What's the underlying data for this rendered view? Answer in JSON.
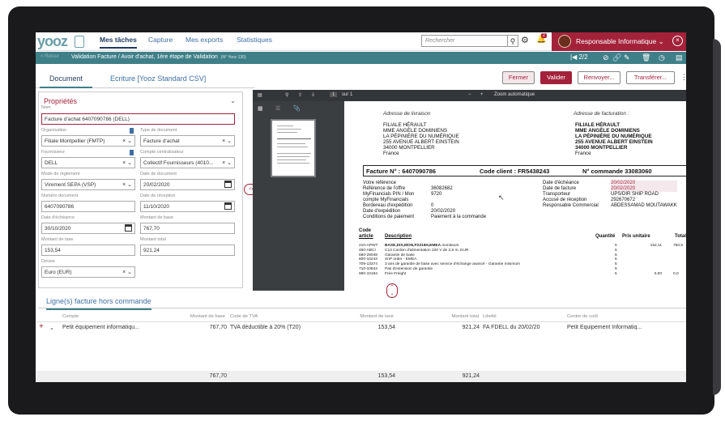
{
  "app": {
    "logo": "yooz"
  },
  "nav": {
    "items": [
      "Mes tâches",
      "Capture",
      "Mes exports",
      "Statistiques"
    ]
  },
  "search": {
    "placeholder": "Rechercher"
  },
  "notifications": {
    "count": "2"
  },
  "user": {
    "name": "Responsable Informatique"
  },
  "breadcrumb": {
    "back": "< Retour",
    "title": "Validation Facture / Avoir d'achat, 1ère étape de Validation",
    "sub": "(N° Yooz 130)"
  },
  "pager": {
    "text": "2/2"
  },
  "tabs": [
    "Document",
    "Ecriture [Yooz Standard CSV]"
  ],
  "actions": {
    "fermer": "Fermer",
    "valider": "Valider",
    "renvoyer": "Renvoyer...",
    "transferer": "Transférer..."
  },
  "props": {
    "title": "Propriétés",
    "nom_label": "Nom",
    "nom": "Facture d'achat 6407090786 (DELL)",
    "org_label": "Organisation",
    "org": "Filiale Montpellier (FMTP)",
    "type_label": "Type de document",
    "type": "Facture d'achat",
    "fourn_label": "Fournisseur",
    "fourn": "DELL",
    "compte_label": "Compte centralisateur",
    "compte": "Collectif Fournisseurs (4010...",
    "mode_label": "Mode de règlement",
    "mode": "Virement SEPA (VSP)",
    "datedoc_label": "Date de document",
    "datedoc": "20/02/2020",
    "numdoc_label": "Numéro document",
    "numdoc": "6407090786",
    "daterec_label": "Date de réception",
    "daterec": "11/10/2020",
    "dateech_label": "Date d'échéance",
    "dateech": "30/10/2020",
    "base_label": "Montant de base",
    "base": "767,70",
    "taxe_label": "Montant de taxe",
    "taxe": "153,54",
    "total_label": "Montant total",
    "total": "921,24",
    "devise_label": "Devise",
    "devise": "Euro (EUR)"
  },
  "viewer": {
    "page": "1",
    "of": "sur 1",
    "zoom": "Zoom automatique"
  },
  "invoice": {
    "livraison_label": "Adresse de livraison",
    "livraison": [
      "FILIALE HÉRAULT",
      "MME ANGÈLE DOMINIENS",
      "LA PÉPINIÈRE DU NUMÉRIQUE",
      "255 AVENUE ALBERT EINSTEIN",
      "34000 MONTPELLIER",
      "France"
    ],
    "facturation_label": "Adresse de facturation :",
    "facturation": [
      "FILIALE HÉRAULT",
      "MME ANGÈLE DOMINIENS",
      "LA PÉPINIÈRE DU NUMÉRIQUE",
      "255 AVENUE ALBERT EINSTEIN",
      "34000 MONTPELLIER",
      "France"
    ],
    "facture_no": "Facture N° : 6407090786",
    "client": "Code client : FR5438243",
    "commande": "N° commande 33083060",
    "left_labels": [
      "Votre référence",
      "Référence de l'offre",
      "MyFinancials PIN / Mon",
      "compte MyFinancials",
      "Bordereau d'expédition",
      "Date d'expédition",
      "Conditions de paiement"
    ],
    "left_values": [
      "",
      "36082682",
      "9720",
      "",
      "0",
      "20/02/2020",
      "Paiement à la commande"
    ],
    "right_labels": [
      "Date d'échéance",
      "Date de facture",
      "Transporteur",
      "Accusé de réception",
      "Responsable Commercial"
    ],
    "right_values": [
      "20/02/2020",
      "20/02/2020",
      "UPS/DIR SHIP ROAD",
      "292670672",
      "ABDESSAMAD MOUTAWAKK"
    ],
    "code_label": "Code",
    "cols": [
      "article",
      "Description",
      "Quantité",
      "Prix unitaire",
      "Total"
    ],
    "lines": [
      {
        "code": "210-APWT",
        "desc": "BASE,DIS,MON,P2319H,EMEA",
        "extra": "moniteurs",
        "qty": "5",
        "pu": "152,11",
        "tot": "760,5"
      },
      {
        "code": "450-ABCI",
        "desc": "C13 Cordon d'alimentation 220 V de 2,5 m, EUR",
        "extra": "",
        "qty": "5",
        "pu": "",
        "tot": ""
      },
      {
        "code": "680-29048",
        "desc": "Garantie de base",
        "extra": "",
        "qty": "5",
        "pu": "",
        "tot": ""
      },
      {
        "code": "800-10243",
        "desc": "SnP order - EMEA.",
        "extra": "",
        "qty": "5",
        "pu": "",
        "tot": ""
      },
      {
        "code": "709-13374",
        "desc": "3 ans de garantie de base avec service d'échange avancé - Garantie minimum",
        "extra": "",
        "qty": "5",
        "pu": "",
        "tot": ""
      },
      {
        "code": "710-10844",
        "desc": "Pas d'extension de garantie",
        "extra": "",
        "qty": "5",
        "pu": "",
        "tot": ""
      },
      {
        "code": "990-10184",
        "desc": "Free Freight",
        "extra": "",
        "qty": "5",
        "pu": "0,00",
        "tot": "0,0"
      }
    ]
  },
  "lines_section": {
    "title": "Ligne(s) facture hors commande",
    "headers": [
      "Compte",
      "Montant de base",
      "Code de TVA",
      "Montant de taxe",
      "Montant total",
      "Libellé",
      "Centre de coût"
    ],
    "row": [
      "Petit équipement informatiqu...",
      "767,70",
      "TVA déductible à 20% (T20)",
      "153,54",
      "921,24",
      "FA FDELL du 20/02/20",
      "Petit Equipement Informatiq..."
    ],
    "totals": [
      "767,70",
      "153,54",
      "921,24"
    ]
  },
  "colors": {
    "brand": "#a3223a",
    "teal": "#3f7f88",
    "link": "#3f6fa5"
  }
}
